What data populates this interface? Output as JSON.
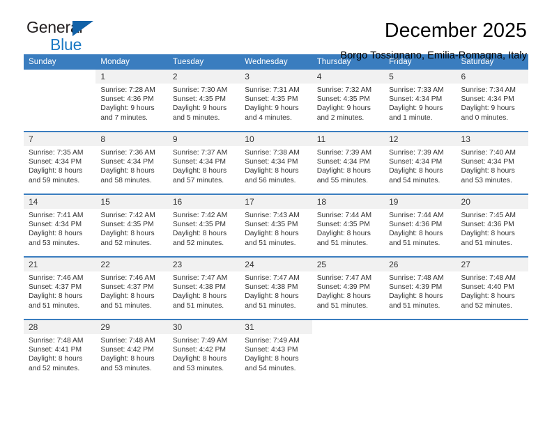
{
  "brand": {
    "name_part1": "General",
    "name_part2": "Blue"
  },
  "header": {
    "month_title": "December 2025",
    "location": "Borgo Tossignano, Emilia-Romagna, Italy"
  },
  "colors": {
    "header_blue": "#3a7dbf",
    "logo_blue": "#1b79c4",
    "daynum_band": "#f1f1f1",
    "text": "#333333"
  },
  "weekday_headers": [
    "Sunday",
    "Monday",
    "Tuesday",
    "Wednesday",
    "Thursday",
    "Friday",
    "Saturday"
  ],
  "weeks": [
    {
      "days": [
        {
          "num": "",
          "sunrise": "",
          "sunset": "",
          "daylight1": "",
          "daylight2": ""
        },
        {
          "num": "1",
          "sunrise": "Sunrise: 7:28 AM",
          "sunset": "Sunset: 4:36 PM",
          "daylight1": "Daylight: 9 hours",
          "daylight2": "and 7 minutes."
        },
        {
          "num": "2",
          "sunrise": "Sunrise: 7:30 AM",
          "sunset": "Sunset: 4:35 PM",
          "daylight1": "Daylight: 9 hours",
          "daylight2": "and 5 minutes."
        },
        {
          "num": "3",
          "sunrise": "Sunrise: 7:31 AM",
          "sunset": "Sunset: 4:35 PM",
          "daylight1": "Daylight: 9 hours",
          "daylight2": "and 4 minutes."
        },
        {
          "num": "4",
          "sunrise": "Sunrise: 7:32 AM",
          "sunset": "Sunset: 4:35 PM",
          "daylight1": "Daylight: 9 hours",
          "daylight2": "and 2 minutes."
        },
        {
          "num": "5",
          "sunrise": "Sunrise: 7:33 AM",
          "sunset": "Sunset: 4:34 PM",
          "daylight1": "Daylight: 9 hours",
          "daylight2": "and 1 minute."
        },
        {
          "num": "6",
          "sunrise": "Sunrise: 7:34 AM",
          "sunset": "Sunset: 4:34 PM",
          "daylight1": "Daylight: 9 hours",
          "daylight2": "and 0 minutes."
        }
      ]
    },
    {
      "days": [
        {
          "num": "7",
          "sunrise": "Sunrise: 7:35 AM",
          "sunset": "Sunset: 4:34 PM",
          "daylight1": "Daylight: 8 hours",
          "daylight2": "and 59 minutes."
        },
        {
          "num": "8",
          "sunrise": "Sunrise: 7:36 AM",
          "sunset": "Sunset: 4:34 PM",
          "daylight1": "Daylight: 8 hours",
          "daylight2": "and 58 minutes."
        },
        {
          "num": "9",
          "sunrise": "Sunrise: 7:37 AM",
          "sunset": "Sunset: 4:34 PM",
          "daylight1": "Daylight: 8 hours",
          "daylight2": "and 57 minutes."
        },
        {
          "num": "10",
          "sunrise": "Sunrise: 7:38 AM",
          "sunset": "Sunset: 4:34 PM",
          "daylight1": "Daylight: 8 hours",
          "daylight2": "and 56 minutes."
        },
        {
          "num": "11",
          "sunrise": "Sunrise: 7:39 AM",
          "sunset": "Sunset: 4:34 PM",
          "daylight1": "Daylight: 8 hours",
          "daylight2": "and 55 minutes."
        },
        {
          "num": "12",
          "sunrise": "Sunrise: 7:39 AM",
          "sunset": "Sunset: 4:34 PM",
          "daylight1": "Daylight: 8 hours",
          "daylight2": "and 54 minutes."
        },
        {
          "num": "13",
          "sunrise": "Sunrise: 7:40 AM",
          "sunset": "Sunset: 4:34 PM",
          "daylight1": "Daylight: 8 hours",
          "daylight2": "and 53 minutes."
        }
      ]
    },
    {
      "days": [
        {
          "num": "14",
          "sunrise": "Sunrise: 7:41 AM",
          "sunset": "Sunset: 4:34 PM",
          "daylight1": "Daylight: 8 hours",
          "daylight2": "and 53 minutes."
        },
        {
          "num": "15",
          "sunrise": "Sunrise: 7:42 AM",
          "sunset": "Sunset: 4:35 PM",
          "daylight1": "Daylight: 8 hours",
          "daylight2": "and 52 minutes."
        },
        {
          "num": "16",
          "sunrise": "Sunrise: 7:42 AM",
          "sunset": "Sunset: 4:35 PM",
          "daylight1": "Daylight: 8 hours",
          "daylight2": "and 52 minutes."
        },
        {
          "num": "17",
          "sunrise": "Sunrise: 7:43 AM",
          "sunset": "Sunset: 4:35 PM",
          "daylight1": "Daylight: 8 hours",
          "daylight2": "and 51 minutes."
        },
        {
          "num": "18",
          "sunrise": "Sunrise: 7:44 AM",
          "sunset": "Sunset: 4:35 PM",
          "daylight1": "Daylight: 8 hours",
          "daylight2": "and 51 minutes."
        },
        {
          "num": "19",
          "sunrise": "Sunrise: 7:44 AM",
          "sunset": "Sunset: 4:36 PM",
          "daylight1": "Daylight: 8 hours",
          "daylight2": "and 51 minutes."
        },
        {
          "num": "20",
          "sunrise": "Sunrise: 7:45 AM",
          "sunset": "Sunset: 4:36 PM",
          "daylight1": "Daylight: 8 hours",
          "daylight2": "and 51 minutes."
        }
      ]
    },
    {
      "days": [
        {
          "num": "21",
          "sunrise": "Sunrise: 7:46 AM",
          "sunset": "Sunset: 4:37 PM",
          "daylight1": "Daylight: 8 hours",
          "daylight2": "and 51 minutes."
        },
        {
          "num": "22",
          "sunrise": "Sunrise: 7:46 AM",
          "sunset": "Sunset: 4:37 PM",
          "daylight1": "Daylight: 8 hours",
          "daylight2": "and 51 minutes."
        },
        {
          "num": "23",
          "sunrise": "Sunrise: 7:47 AM",
          "sunset": "Sunset: 4:38 PM",
          "daylight1": "Daylight: 8 hours",
          "daylight2": "and 51 minutes."
        },
        {
          "num": "24",
          "sunrise": "Sunrise: 7:47 AM",
          "sunset": "Sunset: 4:38 PM",
          "daylight1": "Daylight: 8 hours",
          "daylight2": "and 51 minutes."
        },
        {
          "num": "25",
          "sunrise": "Sunrise: 7:47 AM",
          "sunset": "Sunset: 4:39 PM",
          "daylight1": "Daylight: 8 hours",
          "daylight2": "and 51 minutes."
        },
        {
          "num": "26",
          "sunrise": "Sunrise: 7:48 AM",
          "sunset": "Sunset: 4:39 PM",
          "daylight1": "Daylight: 8 hours",
          "daylight2": "and 51 minutes."
        },
        {
          "num": "27",
          "sunrise": "Sunrise: 7:48 AM",
          "sunset": "Sunset: 4:40 PM",
          "daylight1": "Daylight: 8 hours",
          "daylight2": "and 52 minutes."
        }
      ]
    },
    {
      "days": [
        {
          "num": "28",
          "sunrise": "Sunrise: 7:48 AM",
          "sunset": "Sunset: 4:41 PM",
          "daylight1": "Daylight: 8 hours",
          "daylight2": "and 52 minutes."
        },
        {
          "num": "29",
          "sunrise": "Sunrise: 7:48 AM",
          "sunset": "Sunset: 4:42 PM",
          "daylight1": "Daylight: 8 hours",
          "daylight2": "and 53 minutes."
        },
        {
          "num": "30",
          "sunrise": "Sunrise: 7:49 AM",
          "sunset": "Sunset: 4:42 PM",
          "daylight1": "Daylight: 8 hours",
          "daylight2": "and 53 minutes."
        },
        {
          "num": "31",
          "sunrise": "Sunrise: 7:49 AM",
          "sunset": "Sunset: 4:43 PM",
          "daylight1": "Daylight: 8 hours",
          "daylight2": "and 54 minutes."
        },
        {
          "num": "",
          "sunrise": "",
          "sunset": "",
          "daylight1": "",
          "daylight2": ""
        },
        {
          "num": "",
          "sunrise": "",
          "sunset": "",
          "daylight1": "",
          "daylight2": ""
        },
        {
          "num": "",
          "sunrise": "",
          "sunset": "",
          "daylight1": "",
          "daylight2": ""
        }
      ]
    }
  ]
}
